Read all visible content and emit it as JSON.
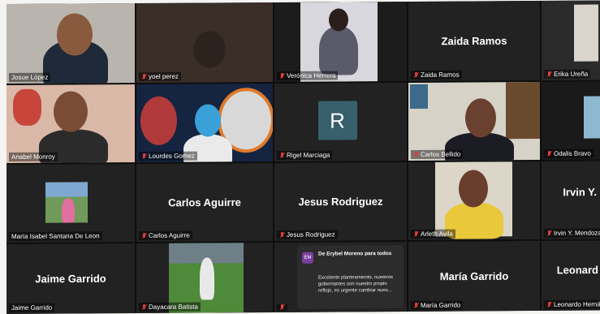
{
  "tiles": [
    {
      "id": "josue",
      "name": "Josue López",
      "kind": "video"
    },
    {
      "id": "yoel",
      "name": "yoel perez",
      "kind": "video"
    },
    {
      "id": "veronica",
      "name": "Verónica Herrera",
      "kind": "video"
    },
    {
      "id": "zaida",
      "name": "Zaida Ramos",
      "big": "Zaida Ramos",
      "kind": "text"
    },
    {
      "id": "erika",
      "name": "Erika Ureña",
      "kind": "video"
    },
    {
      "id": "anabel",
      "name": "Anabel Monroy",
      "kind": "video"
    },
    {
      "id": "lourdes",
      "name": "Lourdes Gomez",
      "kind": "video"
    },
    {
      "id": "rigel",
      "name": "Rigel Marciaga",
      "avatar": "R",
      "kind": "avatar"
    },
    {
      "id": "carlosb",
      "name": "Carlos Bellido",
      "kind": "video"
    },
    {
      "id": "odalis",
      "name": "Odalis Bravo",
      "kind": "video"
    },
    {
      "id": "mariaisabel",
      "name": "María Isabel Santana De Leon",
      "kind": "video"
    },
    {
      "id": "carlosa",
      "name": "Carlos Aguirre",
      "big": "Carlos Aguirre",
      "kind": "text"
    },
    {
      "id": "jesus",
      "name": "Jesus Rodriguez",
      "big": "Jesus Rodriguez",
      "kind": "text"
    },
    {
      "id": "arleth",
      "name": "Arleth Avila",
      "kind": "video"
    },
    {
      "id": "irvin",
      "name": "Irvin Y. Mendoza",
      "big": "Irvin Y.",
      "kind": "text"
    },
    {
      "id": "jaime",
      "name": "Jaime Garrido",
      "big": "Jaime Garrido",
      "kind": "text"
    },
    {
      "id": "dayacara",
      "name": "Dayacara Batista",
      "kind": "video"
    },
    {
      "id": "mariag",
      "name": "María Garrido",
      "big": "María Garrido",
      "kind": "text"
    },
    {
      "id": "leonardo",
      "name": "Leonardo Hernánde",
      "big": "Leonard",
      "kind": "text"
    }
  ],
  "chat": {
    "badge": "EM",
    "header": "De Erybel Moreno para todos",
    "message": "Excelente planteamiento, nuestros gobernantes son nuestro propio reflejo, es urgente cambiar nues..."
  },
  "colors": {
    "accent": "#e23b3b",
    "tile": "#222222",
    "avatar": "#37606c"
  }
}
